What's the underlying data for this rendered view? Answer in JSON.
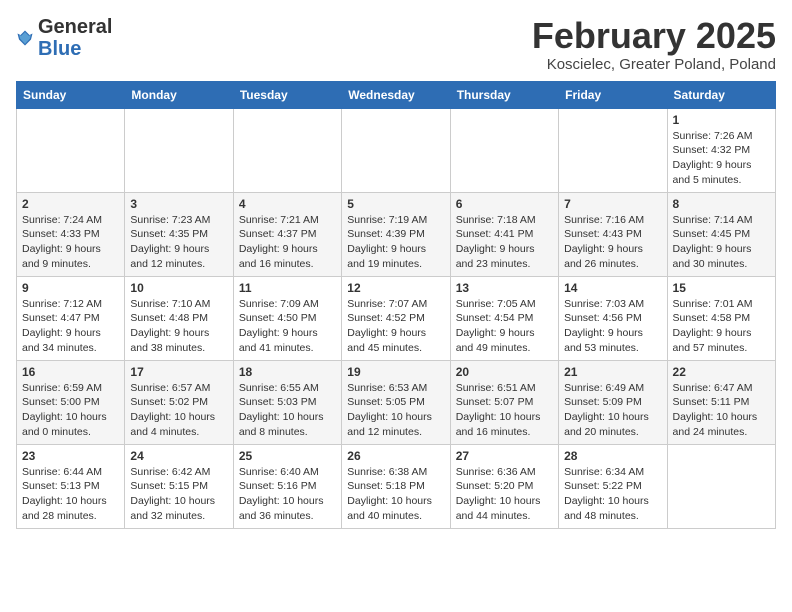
{
  "logo": {
    "general": "General",
    "blue": "Blue"
  },
  "header": {
    "title": "February 2025",
    "subtitle": "Koscielec, Greater Poland, Poland"
  },
  "weekdays": [
    "Sunday",
    "Monday",
    "Tuesday",
    "Wednesday",
    "Thursday",
    "Friday",
    "Saturday"
  ],
  "weeks": [
    [
      {
        "day": "",
        "info": ""
      },
      {
        "day": "",
        "info": ""
      },
      {
        "day": "",
        "info": ""
      },
      {
        "day": "",
        "info": ""
      },
      {
        "day": "",
        "info": ""
      },
      {
        "day": "",
        "info": ""
      },
      {
        "day": "1",
        "info": "Sunrise: 7:26 AM\nSunset: 4:32 PM\nDaylight: 9 hours and 5 minutes."
      }
    ],
    [
      {
        "day": "2",
        "info": "Sunrise: 7:24 AM\nSunset: 4:33 PM\nDaylight: 9 hours and 9 minutes."
      },
      {
        "day": "3",
        "info": "Sunrise: 7:23 AM\nSunset: 4:35 PM\nDaylight: 9 hours and 12 minutes."
      },
      {
        "day": "4",
        "info": "Sunrise: 7:21 AM\nSunset: 4:37 PM\nDaylight: 9 hours and 16 minutes."
      },
      {
        "day": "5",
        "info": "Sunrise: 7:19 AM\nSunset: 4:39 PM\nDaylight: 9 hours and 19 minutes."
      },
      {
        "day": "6",
        "info": "Sunrise: 7:18 AM\nSunset: 4:41 PM\nDaylight: 9 hours and 23 minutes."
      },
      {
        "day": "7",
        "info": "Sunrise: 7:16 AM\nSunset: 4:43 PM\nDaylight: 9 hours and 26 minutes."
      },
      {
        "day": "8",
        "info": "Sunrise: 7:14 AM\nSunset: 4:45 PM\nDaylight: 9 hours and 30 minutes."
      }
    ],
    [
      {
        "day": "9",
        "info": "Sunrise: 7:12 AM\nSunset: 4:47 PM\nDaylight: 9 hours and 34 minutes."
      },
      {
        "day": "10",
        "info": "Sunrise: 7:10 AM\nSunset: 4:48 PM\nDaylight: 9 hours and 38 minutes."
      },
      {
        "day": "11",
        "info": "Sunrise: 7:09 AM\nSunset: 4:50 PM\nDaylight: 9 hours and 41 minutes."
      },
      {
        "day": "12",
        "info": "Sunrise: 7:07 AM\nSunset: 4:52 PM\nDaylight: 9 hours and 45 minutes."
      },
      {
        "day": "13",
        "info": "Sunrise: 7:05 AM\nSunset: 4:54 PM\nDaylight: 9 hours and 49 minutes."
      },
      {
        "day": "14",
        "info": "Sunrise: 7:03 AM\nSunset: 4:56 PM\nDaylight: 9 hours and 53 minutes."
      },
      {
        "day": "15",
        "info": "Sunrise: 7:01 AM\nSunset: 4:58 PM\nDaylight: 9 hours and 57 minutes."
      }
    ],
    [
      {
        "day": "16",
        "info": "Sunrise: 6:59 AM\nSunset: 5:00 PM\nDaylight: 10 hours and 0 minutes."
      },
      {
        "day": "17",
        "info": "Sunrise: 6:57 AM\nSunset: 5:02 PM\nDaylight: 10 hours and 4 minutes."
      },
      {
        "day": "18",
        "info": "Sunrise: 6:55 AM\nSunset: 5:03 PM\nDaylight: 10 hours and 8 minutes."
      },
      {
        "day": "19",
        "info": "Sunrise: 6:53 AM\nSunset: 5:05 PM\nDaylight: 10 hours and 12 minutes."
      },
      {
        "day": "20",
        "info": "Sunrise: 6:51 AM\nSunset: 5:07 PM\nDaylight: 10 hours and 16 minutes."
      },
      {
        "day": "21",
        "info": "Sunrise: 6:49 AM\nSunset: 5:09 PM\nDaylight: 10 hours and 20 minutes."
      },
      {
        "day": "22",
        "info": "Sunrise: 6:47 AM\nSunset: 5:11 PM\nDaylight: 10 hours and 24 minutes."
      }
    ],
    [
      {
        "day": "23",
        "info": "Sunrise: 6:44 AM\nSunset: 5:13 PM\nDaylight: 10 hours and 28 minutes."
      },
      {
        "day": "24",
        "info": "Sunrise: 6:42 AM\nSunset: 5:15 PM\nDaylight: 10 hours and 32 minutes."
      },
      {
        "day": "25",
        "info": "Sunrise: 6:40 AM\nSunset: 5:16 PM\nDaylight: 10 hours and 36 minutes."
      },
      {
        "day": "26",
        "info": "Sunrise: 6:38 AM\nSunset: 5:18 PM\nDaylight: 10 hours and 40 minutes."
      },
      {
        "day": "27",
        "info": "Sunrise: 6:36 AM\nSunset: 5:20 PM\nDaylight: 10 hours and 44 minutes."
      },
      {
        "day": "28",
        "info": "Sunrise: 6:34 AM\nSunset: 5:22 PM\nDaylight: 10 hours and 48 minutes."
      },
      {
        "day": "",
        "info": ""
      }
    ]
  ]
}
